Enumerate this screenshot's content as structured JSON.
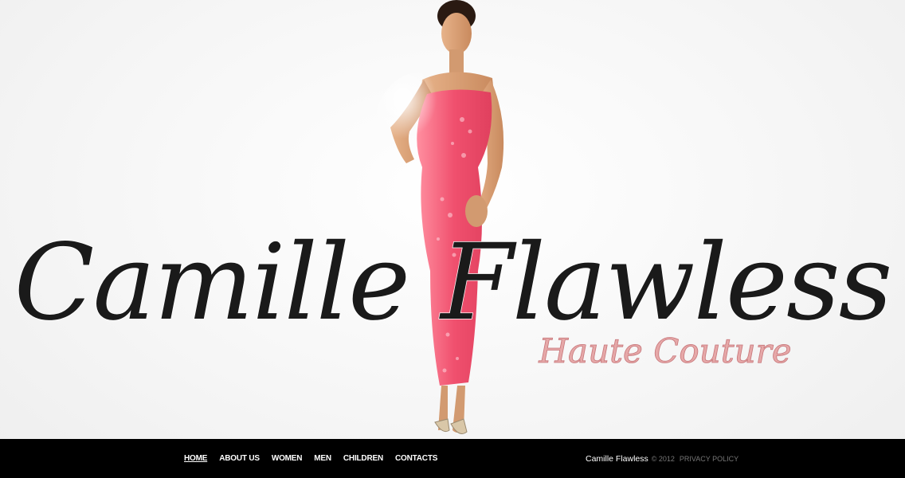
{
  "logo": {
    "title": "Camille Flawless",
    "tagline": "Haute Couture"
  },
  "hero": {
    "image": "model-in-pink-dress"
  },
  "nav": {
    "items": [
      {
        "label": "HOME",
        "active": true
      },
      {
        "label": "ABOUT US",
        "active": false
      },
      {
        "label": "WOMEN",
        "active": false
      },
      {
        "label": "MEN",
        "active": false
      },
      {
        "label": "CHILDREN",
        "active": false
      },
      {
        "label": "CONTACTS",
        "active": false
      }
    ]
  },
  "footer": {
    "brand": "Camille Flawless",
    "year": "© 2012",
    "privacy": "PRIVACY POLICY"
  },
  "colors": {
    "background": "#f4f4f4",
    "footer": "#000000",
    "dress": "#f0506e",
    "tagline": "#e6a8a8"
  }
}
